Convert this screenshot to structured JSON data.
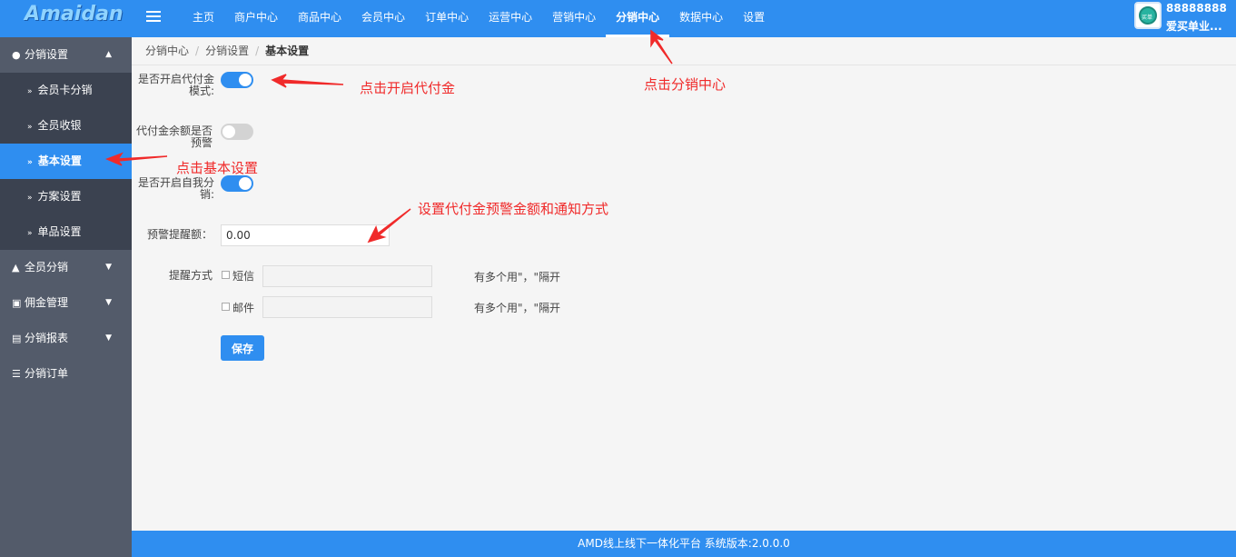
{
  "app": {
    "logo": "Amaidan"
  },
  "nav": {
    "items": [
      "主页",
      "商户中心",
      "商品中心",
      "会员中心",
      "订单中心",
      "运营中心",
      "营销中心",
      "分销中心",
      "数据中心",
      "设置"
    ],
    "active_index": 7
  },
  "user": {
    "id": "88888888",
    "name": "爱买单业...",
    "avatar_text": "买单"
  },
  "sidebar": {
    "group_distribution_settings": "分销设置",
    "sub_items": [
      "会员卡分销",
      "全员收银",
      "基本设置",
      "方案设置",
      "单品设置"
    ],
    "active_sub_index": 2,
    "group_all_distribution": "全员分销",
    "group_commission": "佣金管理",
    "group_report": "分销报表",
    "group_orders": "分销订单"
  },
  "breadcrumb": {
    "items": [
      "分销中心",
      "分销设置",
      "基本设置"
    ],
    "separator": "/"
  },
  "form": {
    "proxy_pay_label": "是否开启代付金模式:",
    "proxy_pay_on": true,
    "balance_warn_label": "代付金余额是否预警",
    "balance_warn_on": false,
    "self_dist_label": "是否开启自我分销:",
    "self_dist_on": true,
    "warn_amount_label": "预警提醒额：",
    "warn_amount_value": "0.00",
    "remind_method_label": "提醒方式",
    "sms_label": "短信",
    "email_label": "邮件",
    "sms_hint": "有多个用\"，\"隔开",
    "email_hint": "有多个用\"，\"隔开",
    "save_label": "保存"
  },
  "annotations": {
    "enable_proxy": "点击开启代付金",
    "click_distribution": "点击分销中心",
    "click_basic": "点击基本设置",
    "set_warning": "设置代付金预警金额和通知方式"
  },
  "footer": {
    "text": "AMD线上线下一体化平台 系统版本:2.0.0.0"
  },
  "colors": {
    "primary": "#2f8ef0",
    "sidebar": "#535b6a",
    "sidebar_sub": "#3b4250",
    "annotation": "#f02a2a"
  }
}
